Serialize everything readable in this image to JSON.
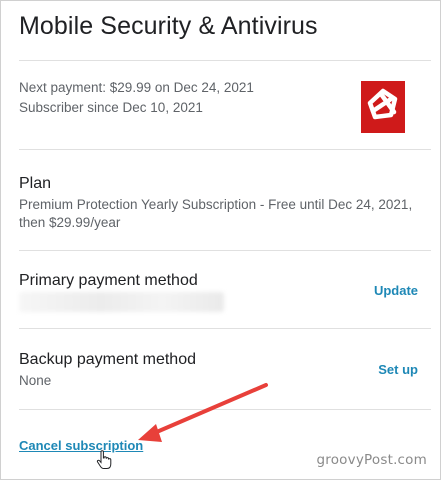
{
  "app": {
    "title": "Mobile Security & Antivirus"
  },
  "billing": {
    "next_payment": "Next payment: $29.99 on Dec 24, 2021",
    "subscriber_since": "Subscriber since Dec 10, 2021",
    "logo_icon": "antivirus-app-logo"
  },
  "plan": {
    "label": "Plan",
    "description_line1": "Premium Protection Yearly Subscription - Free until Dec 24, 2021,",
    "description_line2": "then $29.99/year"
  },
  "primary_payment": {
    "label": "Primary payment method",
    "action": "Update"
  },
  "backup_payment": {
    "label": "Backup payment method",
    "value": "None",
    "action": "Set up"
  },
  "cancel": {
    "label": "Cancel subscription"
  },
  "annotation": {
    "arrow_color": "#e8403a"
  },
  "watermark": {
    "text": "groovyPost.com"
  },
  "colors": {
    "link": "#1e88b6",
    "logo_bg": "#cf1a1a"
  }
}
